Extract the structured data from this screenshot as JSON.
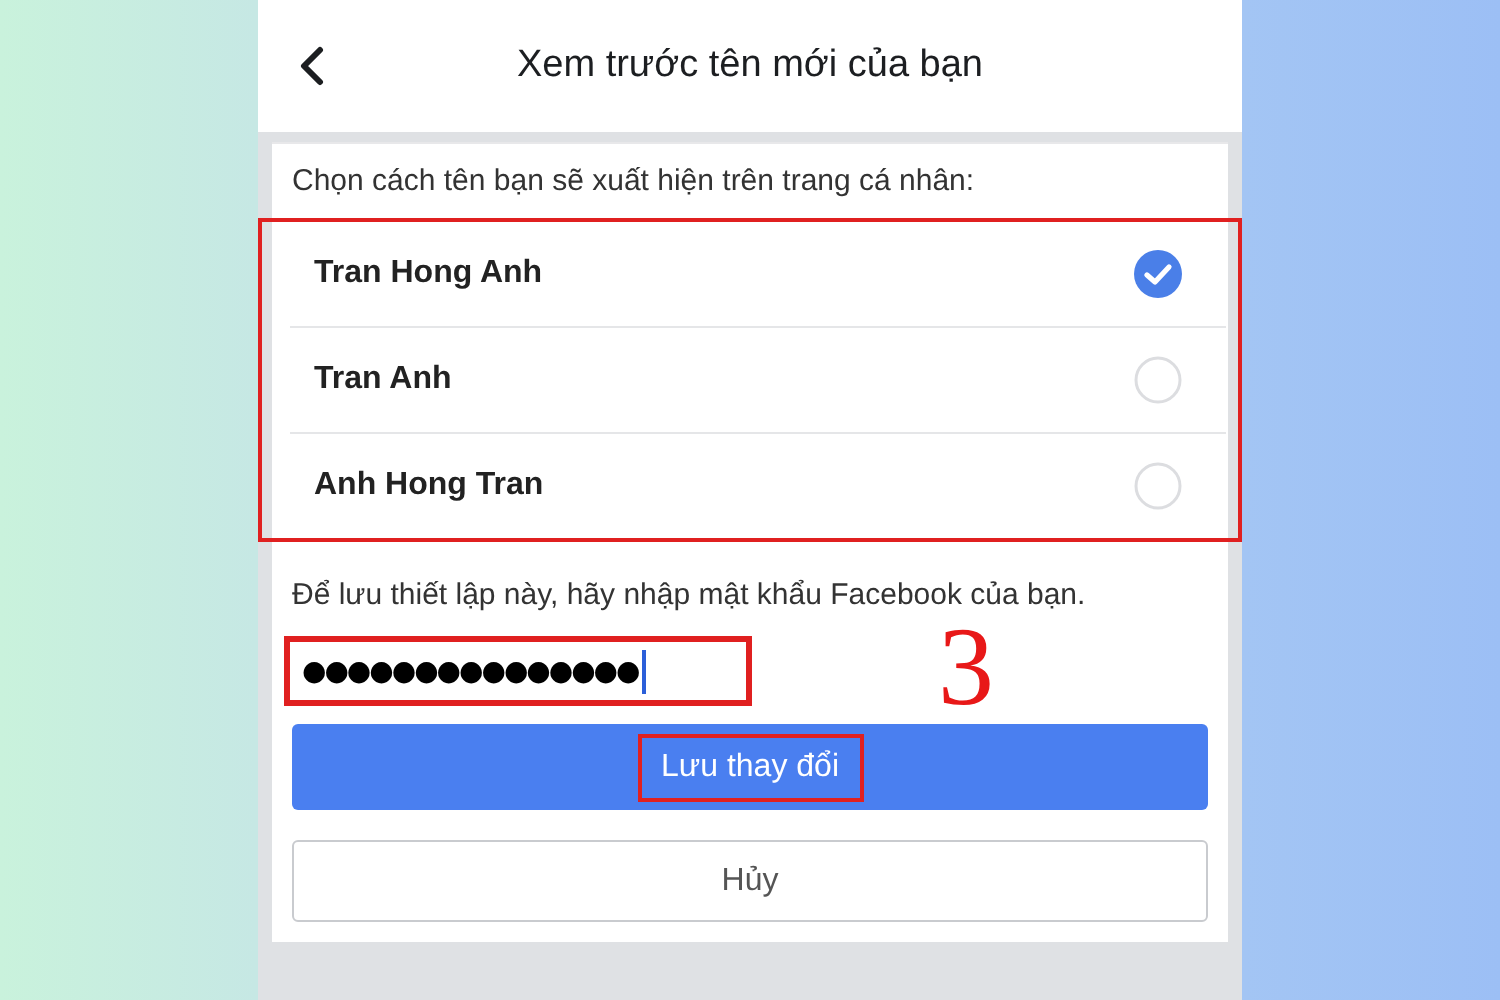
{
  "header": {
    "title": "Xem trước tên mới của bạn"
  },
  "prompt": "Chọn cách tên bạn sẽ xuất hiện trên trang cá nhân:",
  "options_highlighted": true,
  "options": [
    {
      "name": "Tran Hong Anh",
      "selected": true
    },
    {
      "name": "Tran Anh",
      "selected": false
    },
    {
      "name": "Anh Hong Tran",
      "selected": false
    }
  ],
  "password_prompt": "Để lưu thiết lập này, hãy nhập mật khẩu Facebook của bạn.",
  "password": {
    "value": "●●●●●●●●●●●●●●●",
    "highlighted": true
  },
  "save_button": {
    "label": "Lưu thay đổi",
    "highlighted": true
  },
  "cancel_button": {
    "label": "Hủy"
  },
  "annotation": {
    "step": "3"
  }
}
